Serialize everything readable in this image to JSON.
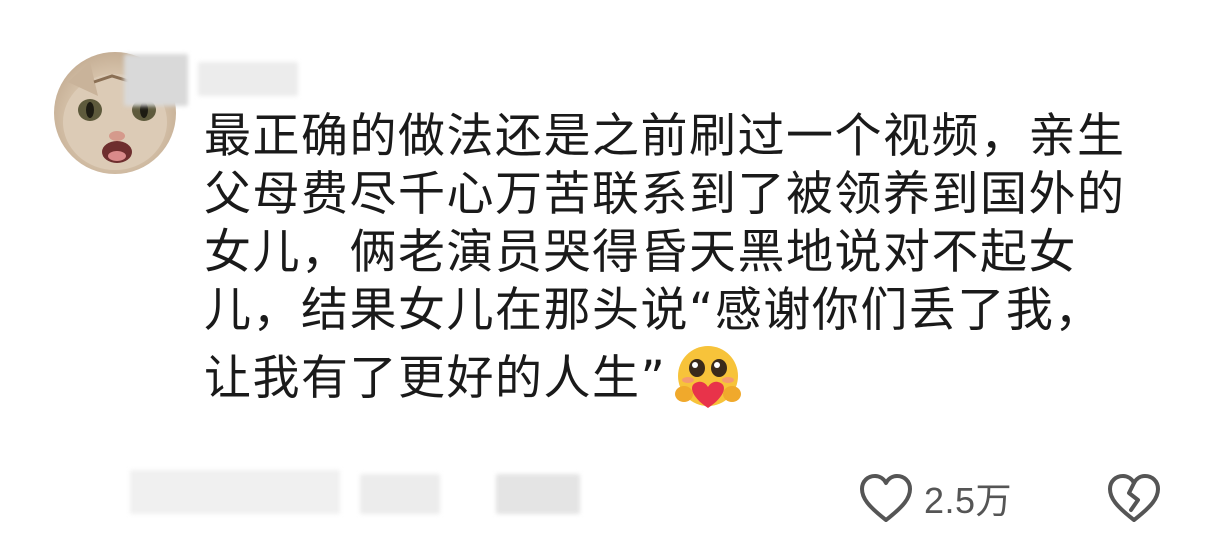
{
  "comment": {
    "avatar_icon": "cat-avatar",
    "text_lines": [
      "最正确的做法还是之前刷过一个视频，亲生",
      "父母费尽千心万苦联系到了被领养到国外的",
      "女儿，俩老演员哭得昏天黑地说对不起女",
      "儿，结果女儿在那头说“感谢你们丢了我，",
      "让我有了更好的人生”"
    ],
    "emoji": "hugging-heart-emoji",
    "like_icon": "heart-outline-icon",
    "like_count": "2.5万",
    "dislike_icon": "broken-heart-icon"
  }
}
